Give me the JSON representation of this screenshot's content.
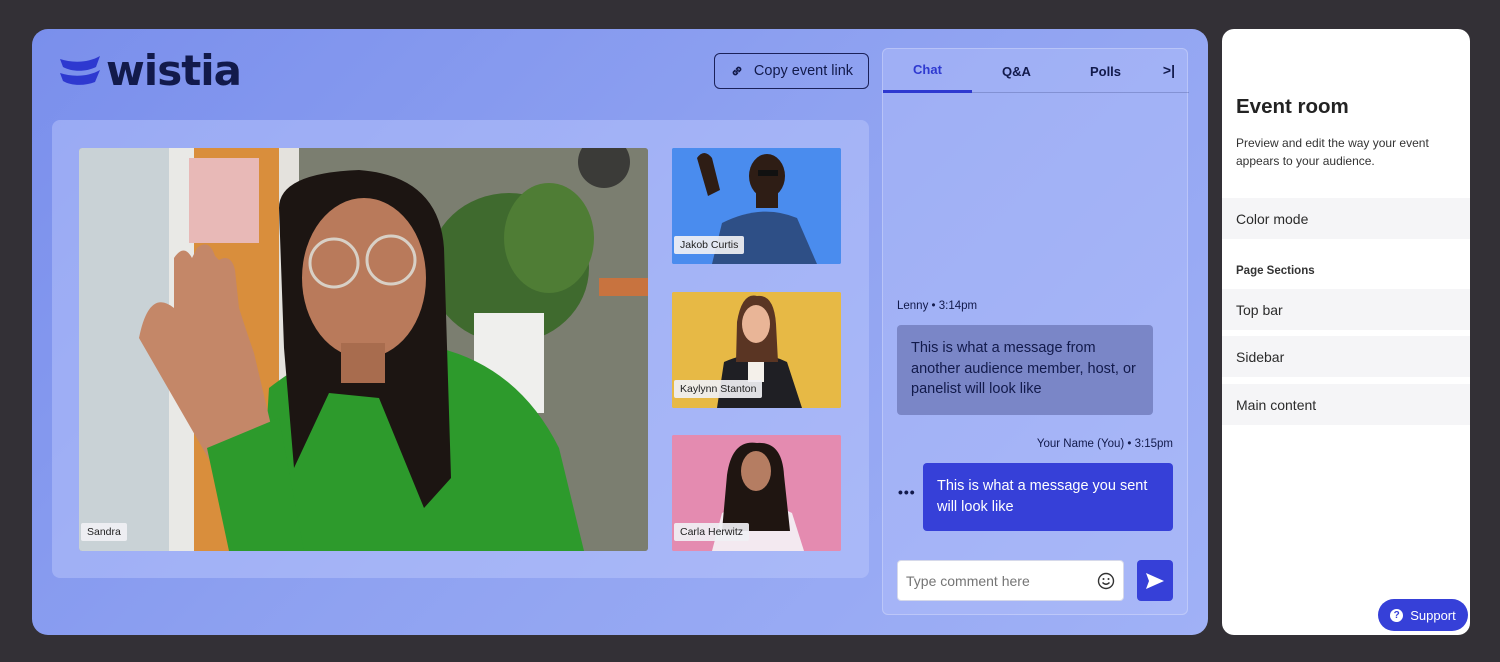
{
  "brand": {
    "logo_text": "wistia"
  },
  "topbar": {
    "copy_link_label": "Copy event link"
  },
  "stage": {
    "main_speaker": "Sandra",
    "thumbnails": [
      {
        "name": "Jakob Curtis"
      },
      {
        "name": "Kaylynn Stanton"
      },
      {
        "name": "Carla Herwitz"
      }
    ]
  },
  "chat": {
    "tabs": [
      {
        "label": "Chat",
        "active": true
      },
      {
        "label": "Q&A"
      },
      {
        "label": "Polls"
      }
    ],
    "collapse_icon": ">|",
    "messages": [
      {
        "author": "Lenny",
        "time": "3:14pm",
        "meta": "Lenny • 3:14pm",
        "text": "This is what a message from another audience member, host, or panelist will look like"
      },
      {
        "author": "Your Name (You)",
        "time": "3:15pm",
        "meta": "Your Name (You) • 3:15pm",
        "text": "This is what a message you sent will look like"
      }
    ],
    "more_icon": "•••",
    "input_placeholder": "Type comment here"
  },
  "sidebar": {
    "title": "Event room",
    "description": "Preview and edit the way your event appears to your audience.",
    "color_mode_label": "Color mode",
    "sections_heading": "Page Sections",
    "sections": [
      {
        "label": "Top bar"
      },
      {
        "label": "Sidebar"
      },
      {
        "label": "Main content"
      }
    ],
    "support_label": "Support"
  },
  "colors": {
    "page_bg": "#333036",
    "stage_bg": "#8fa2f1",
    "accent": "#3640d8",
    "brand_navy": "#121a4b",
    "other_bubble": "#7a86c7"
  }
}
